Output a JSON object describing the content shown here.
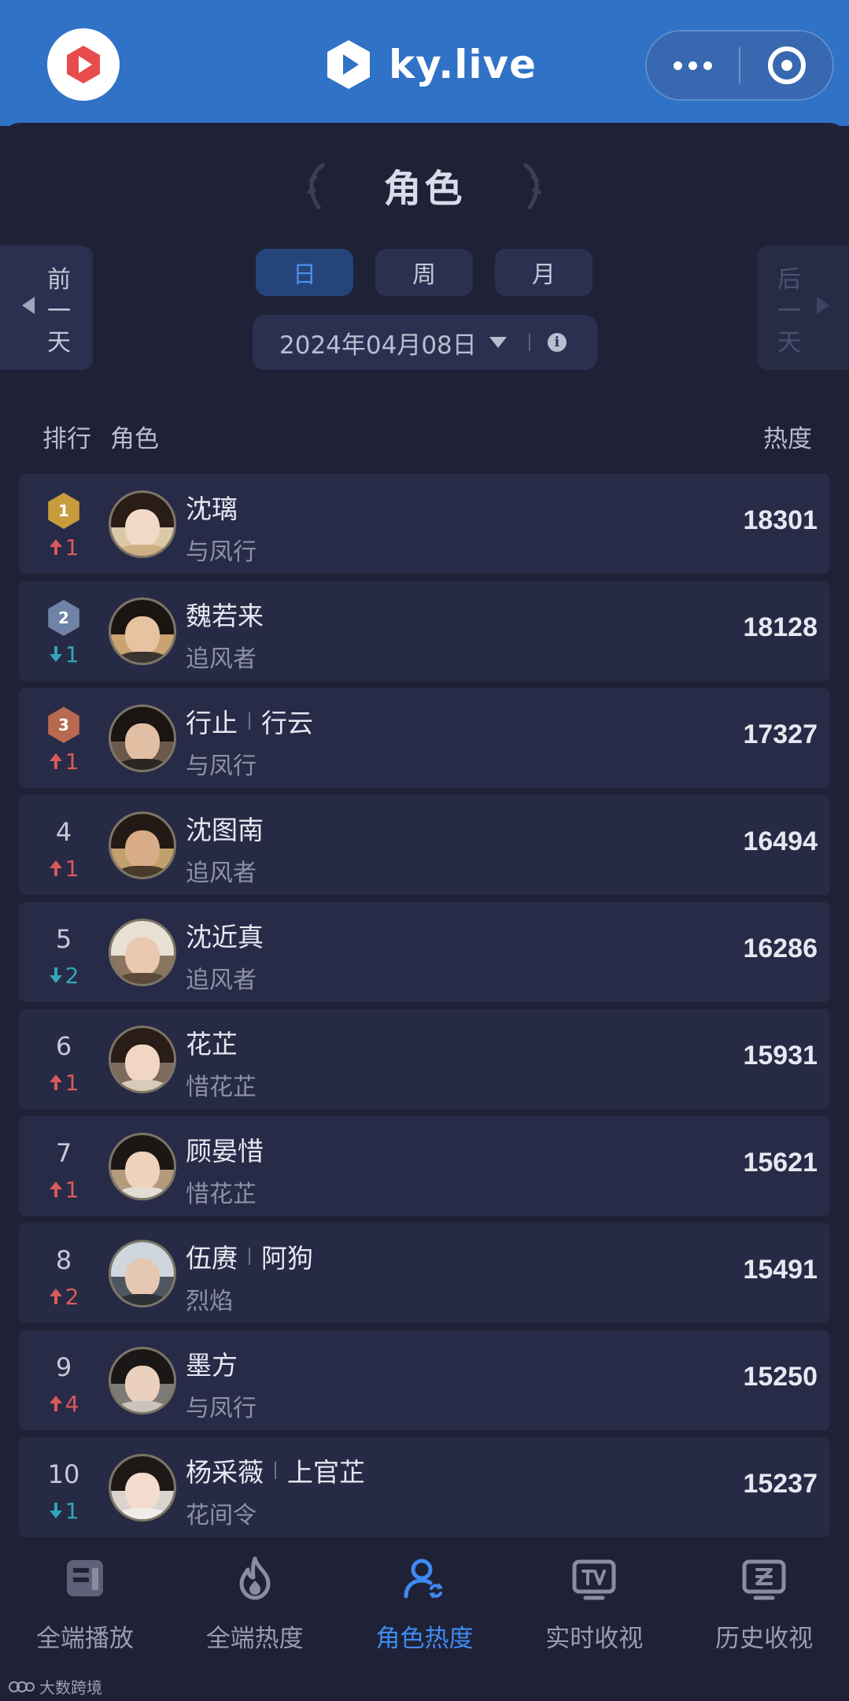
{
  "header": {
    "brand": "ky.live",
    "colors": {
      "bar": "#2f72c6",
      "logo_red": "#e84b4b"
    }
  },
  "page": {
    "title": "角色",
    "prev_day": "前一天",
    "next_day": "后一天",
    "period_tabs": [
      {
        "label": "日",
        "active": true
      },
      {
        "label": "周",
        "active": false
      },
      {
        "label": "月",
        "active": false
      }
    ],
    "date": "2024年04月08日",
    "columns": {
      "rank": "排行",
      "role": "角色",
      "heat": "热度"
    }
  },
  "rows": [
    {
      "rank": "1",
      "medal": "gold",
      "change_dir": "up",
      "change": "1",
      "name": "沈璃",
      "name2": "",
      "drama": "与凤行",
      "heat": "18301"
    },
    {
      "rank": "2",
      "medal": "silver",
      "change_dir": "down",
      "change": "1",
      "name": "魏若来",
      "name2": "",
      "drama": "追风者",
      "heat": "18128"
    },
    {
      "rank": "3",
      "medal": "bronze",
      "change_dir": "up",
      "change": "1",
      "name": "行止",
      "name2": "行云",
      "drama": "与凤行",
      "heat": "17327"
    },
    {
      "rank": "4",
      "medal": "",
      "change_dir": "up",
      "change": "1",
      "name": "沈图南",
      "name2": "",
      "drama": "追风者",
      "heat": "16494"
    },
    {
      "rank": "5",
      "medal": "",
      "change_dir": "down",
      "change": "2",
      "name": "沈近真",
      "name2": "",
      "drama": "追风者",
      "heat": "16286"
    },
    {
      "rank": "6",
      "medal": "",
      "change_dir": "up",
      "change": "1",
      "name": "花芷",
      "name2": "",
      "drama": "惜花芷",
      "heat": "15931"
    },
    {
      "rank": "7",
      "medal": "",
      "change_dir": "up",
      "change": "1",
      "name": "顾晏惜",
      "name2": "",
      "drama": "惜花芷",
      "heat": "15621"
    },
    {
      "rank": "8",
      "medal": "",
      "change_dir": "up",
      "change": "2",
      "name": "伍赓",
      "name2": "阿狗",
      "drama": "烈焰",
      "heat": "15491"
    },
    {
      "rank": "9",
      "medal": "",
      "change_dir": "up",
      "change": "4",
      "name": "墨方",
      "name2": "",
      "drama": "与凤行",
      "heat": "15250"
    },
    {
      "rank": "10",
      "medal": "",
      "change_dir": "down",
      "change": "1",
      "name": "杨采薇",
      "name2": "上官芷",
      "drama": "花间令",
      "heat": "15237"
    }
  ],
  "tabbar": [
    {
      "label": "全端播放",
      "icon": "play-list-icon",
      "active": false
    },
    {
      "label": "全端热度",
      "icon": "flame-icon",
      "active": false
    },
    {
      "label": "角色热度",
      "icon": "person-refresh-icon",
      "active": true
    },
    {
      "label": "实时收视",
      "icon": "tv-icon",
      "active": false
    },
    {
      "label": "历史收视",
      "icon": "history-tv-icon",
      "active": false
    }
  ],
  "watermark": "大数跨境"
}
